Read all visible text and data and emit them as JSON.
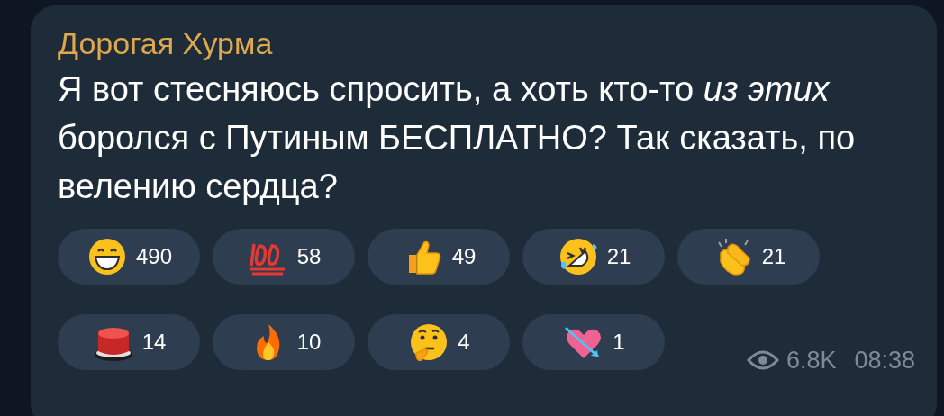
{
  "message": {
    "author": "Дорогая Хурма",
    "text": "Я вот стесняюсь спросить, а хоть кто-то *из этих* боролся с Путиным БЕСПЛАТНО? Так сказать, по велению сердца?",
    "reactions": [
      {
        "kind": "grin",
        "count": "490"
      },
      {
        "kind": "hundred",
        "count": "58"
      },
      {
        "kind": "thumbsup",
        "count": "49"
      },
      {
        "kind": "rofl",
        "count": "21"
      },
      {
        "kind": "clap",
        "count": "21"
      },
      {
        "kind": "redbutton",
        "count": "14"
      },
      {
        "kind": "fire",
        "count": "10"
      },
      {
        "kind": "thinking",
        "count": "4"
      },
      {
        "kind": "heart",
        "count": "1"
      }
    ],
    "views": "6.8K",
    "time": "08:38"
  }
}
